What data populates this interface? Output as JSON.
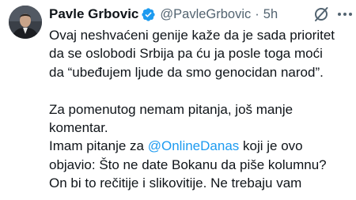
{
  "tweet": {
    "author": {
      "display_name": "Pavle Grbovic",
      "handle": "@PavleGrbovic",
      "verified": true
    },
    "separator": "·",
    "time": "5h",
    "icons": {
      "grok": "grok-icon",
      "more": "more-icon"
    },
    "text": {
      "p1_line1": "Ovaj neshvaćeni genije kaže da je sada prioritet",
      "p1_line2": "da se oslobodi Srbija pa ću ja posle toga moći",
      "p1_line3": "da “ubeđujem ljude da smo genocidan narod”.",
      "p2_line1": "Za pomenutog nemam pitanja, još manje",
      "p2_line2": "komentar.",
      "p2_line3_before": "Imam pitanje za ",
      "p2_line3_mention": "@OnlineDanas",
      "p2_line3_after": " koji je ovo",
      "p2_line4": "objavio: Što ne date Bokanu da piše kolumnu?",
      "p2_line5": "On bi to rečitije i slikovitije. Ne trebaju vam"
    },
    "colors": {
      "accent": "#1d9bf0",
      "text": "#0f1419",
      "muted": "#536471"
    }
  }
}
